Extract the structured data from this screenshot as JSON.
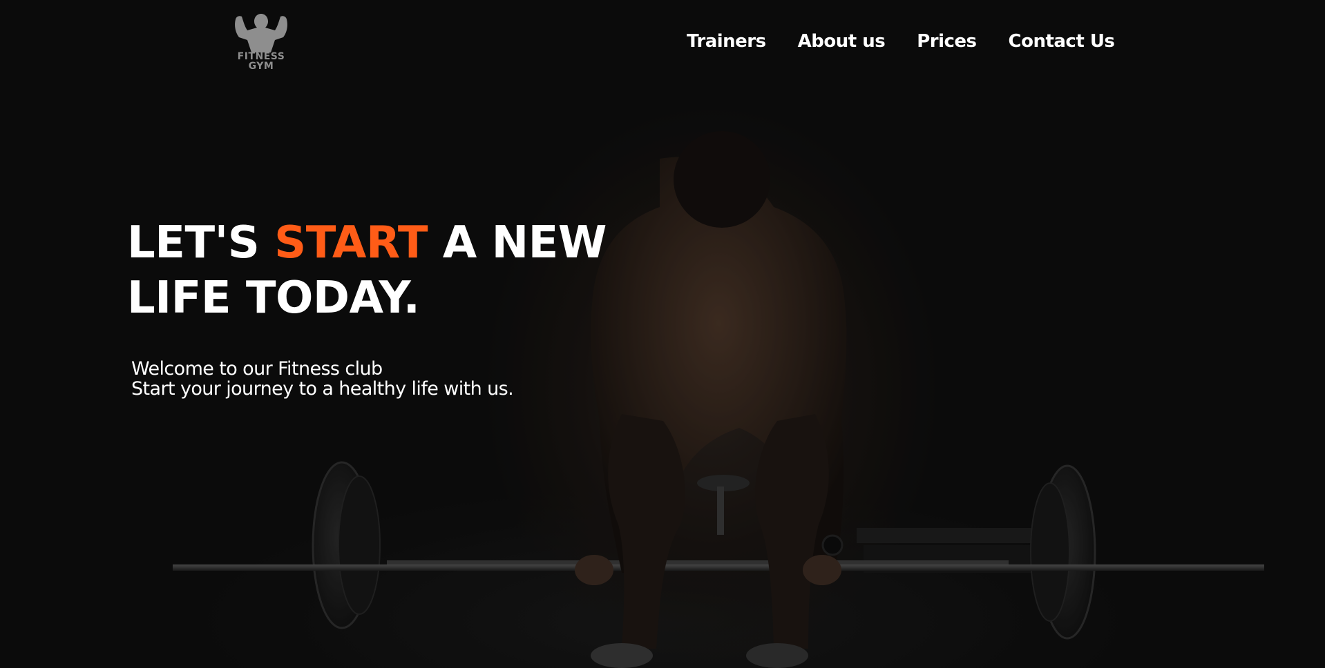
{
  "brand": {
    "logo_line1": "FITNESS",
    "logo_line2": "GYM",
    "logo_color": "#8e8e8e"
  },
  "nav": {
    "items": [
      {
        "label": "Trainers"
      },
      {
        "label": "About us"
      },
      {
        "label": "Prices"
      },
      {
        "label": "Contact Us"
      }
    ]
  },
  "hero": {
    "headline_before": "LET'S ",
    "headline_accent": "START",
    "headline_after_line1": " A NEW",
    "headline_line2": "LIFE TODAY.",
    "subtitle_line1": "Welcome to our Fitness club",
    "subtitle_line2": "Start your journey to a healthy life with us.",
    "background_image": "weightlifter-deadlift-photo"
  },
  "colors": {
    "background": "#0b0b0b",
    "text": "#ffffff",
    "accent": "#ff5c17"
  }
}
